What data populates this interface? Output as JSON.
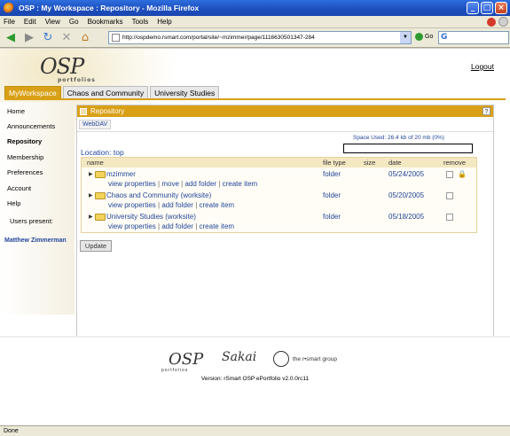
{
  "window": {
    "title": "OSP : My Workspace : Repository - Mozilla Firefox"
  },
  "menu": [
    "File",
    "Edit",
    "View",
    "Go",
    "Bookmarks",
    "Tools",
    "Help"
  ],
  "nav": {
    "url": "http://ospdemo.rsmart.com/portal/site/~mzimmer/page/1116630501347-284",
    "go_label": "Go"
  },
  "header": {
    "logo_text": "OSP",
    "logo_sub": "portfolios",
    "logout": "Logout"
  },
  "tabs": [
    {
      "label": "MyWorkspace"
    },
    {
      "label": "Chaos and Community"
    },
    {
      "label": "University Studies"
    }
  ],
  "sidebar": {
    "items": [
      "Home",
      "Announcements",
      "Repository",
      "Membership",
      "Preferences",
      "Account",
      "Help"
    ],
    "users_present_label": "Users present:",
    "present_user": "Matthew Zimmerman"
  },
  "portlet": {
    "title": "Repository",
    "help": "?",
    "webdav": "WebDAV",
    "space_used": "Space Used: 26.4 kb of 20 mb  (0%)",
    "location_label": "Location:",
    "location_value": "top",
    "columns": {
      "name": "name",
      "file_type": "file type",
      "size": "size",
      "date": "date",
      "remove": "remove"
    },
    "rows": [
      {
        "name": "mzimmer",
        "actions": [
          "view properties",
          "move",
          "add folder",
          "create item"
        ],
        "type": "folder",
        "date": "05/24/2005"
      },
      {
        "name": "Chaos and Community (worksite)",
        "actions": [
          "view properties",
          "add folder",
          "create item"
        ],
        "type": "folder",
        "date": "05/20/2005"
      },
      {
        "name": "University Studies (worksite)",
        "actions": [
          "view properties",
          "add folder",
          "create item"
        ],
        "type": "folder",
        "date": "05/18/2005"
      }
    ],
    "update_button": "Update"
  },
  "footer": {
    "osp": "OSP",
    "osp_sub": "portfolios",
    "sakai": "Sakai",
    "rsmart": "the r•smart group",
    "version": "Version: rSmart OSP ePortfolio v2.0.0rc11"
  },
  "status": "Done"
}
